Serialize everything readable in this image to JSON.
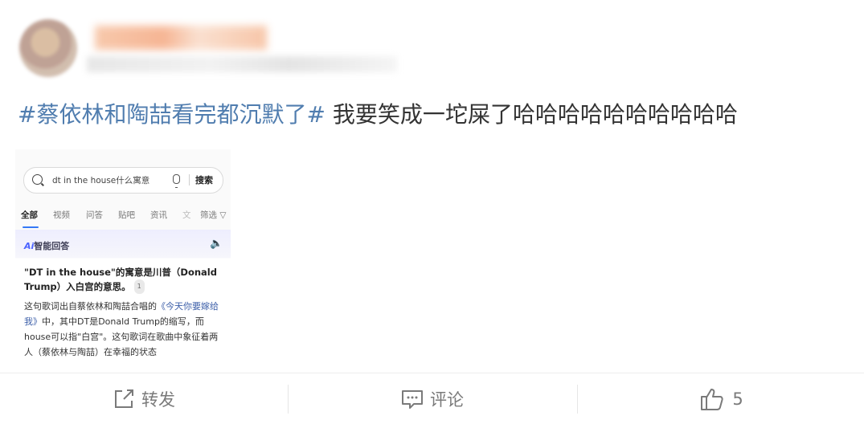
{
  "post": {
    "topic": "#蔡依林和陶喆看完都沉默了#",
    "text": " 我要笑成一坨屎了哈哈哈哈哈哈哈哈哈哈"
  },
  "screenshot": {
    "search": {
      "query": "dt in the house什么寓意",
      "button": "搜索"
    },
    "tabs": [
      "全部",
      "视频",
      "问答",
      "贴吧",
      "资讯",
      "文",
      "筛选"
    ],
    "ai": {
      "badge_ai": "Ai",
      "badge_label": "智能回答",
      "headline": "\"DT in the house\"的寓意是川普（Donald Trump）入白宫的意思。",
      "cite": "1",
      "para_1": "这句歌词出自蔡依林和陶喆合唱的",
      "song": "《今天你要嫁给我》",
      "para_2": "中，其中DT是Donald Trump的缩写，而house可以指\"白宫\"。这句歌词在歌曲中象征着两人（蔡依林与陶喆）在幸福的状态"
    }
  },
  "actions": {
    "repost": "转发",
    "comment": "评论",
    "like_count": "5"
  }
}
